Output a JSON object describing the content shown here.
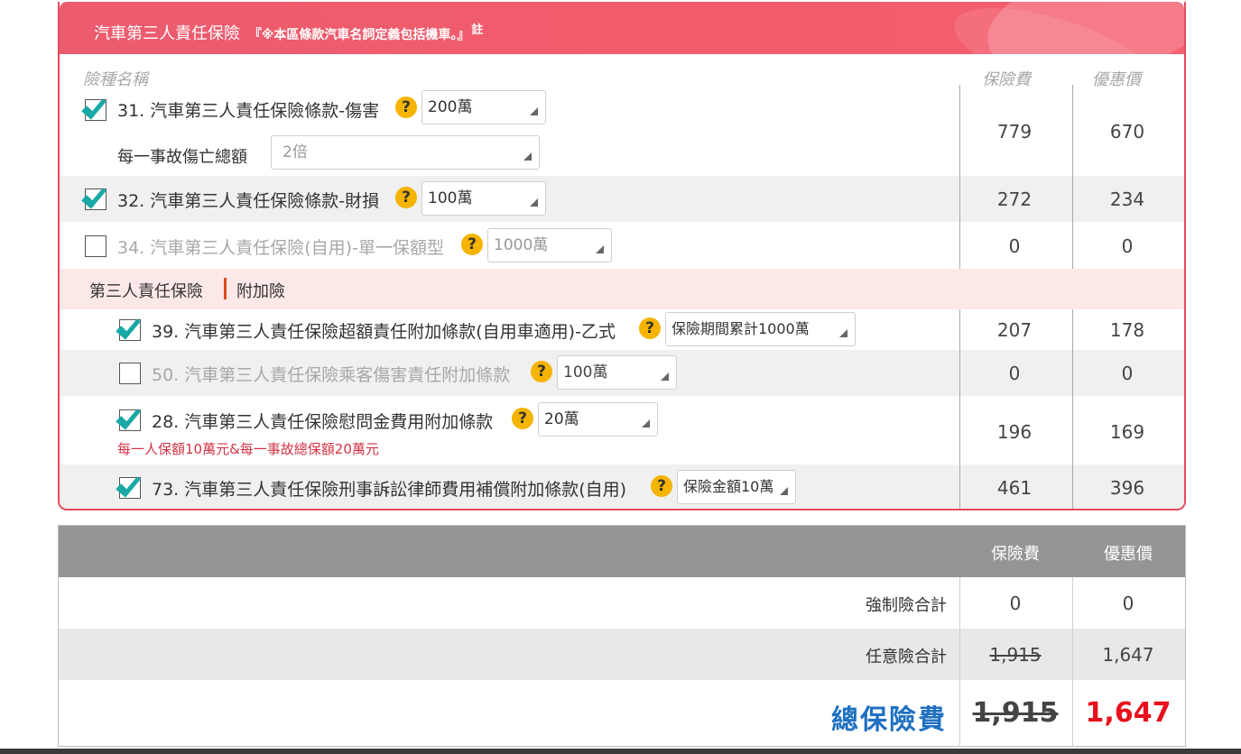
{
  "panel": {
    "title": "汽車第三人責任保險",
    "title_note": "『※本區條款汽車名詞定義包括機車。』",
    "title_sup": "註",
    "col_name": "險種名稱",
    "col_premium": "保險費",
    "col_discount": "優惠價",
    "accent_color": "#ec5b6e"
  },
  "rows": [
    {
      "checked": true,
      "label": "31. 汽車第三人責任保險條款-傷害",
      "help": "?",
      "select": "200萬",
      "sub_label": "每一事故傷亡總額",
      "sub_select": "2倍",
      "premium": "779",
      "discount": "670"
    },
    {
      "checked": true,
      "label": "32. 汽車第三人責任保險條款-財損",
      "help": "?",
      "select": "100萬",
      "premium": "272",
      "discount": "234"
    },
    {
      "checked": false,
      "label": "34. 汽車第三人責任保險(自用)-單一保額型",
      "help": "?",
      "select": "1000萬",
      "premium": "0",
      "discount": "0"
    }
  ],
  "section": {
    "left": "第三人責任保險",
    "right": "附加險"
  },
  "addons": [
    {
      "checked": true,
      "label": "39. 汽車第三人責任保險超額責任附加條款(自用車適用)-乙式",
      "help": "?",
      "select": "保險期間累計1000萬",
      "premium": "207",
      "discount": "178"
    },
    {
      "checked": false,
      "label": "50. 汽車第三人責任保險乘客傷害責任附加條款",
      "help": "?",
      "select": "100萬",
      "premium": "0",
      "discount": "0"
    },
    {
      "checked": true,
      "label": "28. 汽車第三人責任保險慰問金費用附加條款",
      "help": "?",
      "select": "20萬",
      "note": "每一人保額10萬元&每一事故總保額20萬元",
      "premium": "196",
      "discount": "169"
    },
    {
      "checked": true,
      "label": "73. 汽車第三人責任保險刑事訴訟律師費用補償附加條款(自用)",
      "help": "?",
      "select": "保險金額10萬",
      "premium": "461",
      "discount": "396"
    }
  ],
  "totals": {
    "col_premium": "保險費",
    "col_discount": "優惠價",
    "compulsory_label": "強制險合計",
    "compulsory_premium": "0",
    "compulsory_discount": "0",
    "voluntary_label": "任意險合計",
    "voluntary_premium": "1,915",
    "voluntary_discount": "1,647",
    "grand_label": "總保險費",
    "grand_premium": "1,915",
    "grand_discount": "1,647"
  }
}
